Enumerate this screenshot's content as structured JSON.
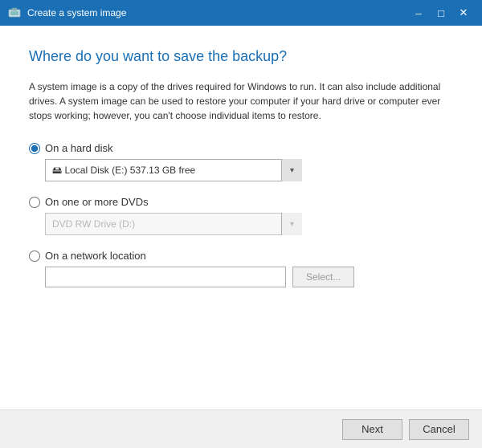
{
  "titleBar": {
    "title": "Create a system image",
    "minimizeLabel": "–",
    "maximizeLabel": "□",
    "closeLabel": "✕"
  },
  "heading": "Where do you want to save the backup?",
  "description": "A system image is a copy of the drives required for Windows to run. It can also include additional drives. A system image can be used to restore your computer if your hard drive or computer ever stops working; however, you can't choose individual items to restore.",
  "options": {
    "hardDisk": {
      "label": "On a hard disk",
      "selected": true,
      "drives": [
        "Local Disk (E:)  537.13 GB free"
      ],
      "selectedDrive": "Local Disk (E:)  537.13 GB free"
    },
    "dvd": {
      "label": "On one or more DVDs",
      "selected": false,
      "drives": [
        "DVD RW Drive (D:)"
      ],
      "selectedDrive": "DVD RW Drive (D:)"
    },
    "network": {
      "label": "On a network location",
      "selected": false,
      "placeholder": "",
      "selectButtonLabel": "Select..."
    }
  },
  "footer": {
    "nextLabel": "Next",
    "cancelLabel": "Cancel"
  }
}
